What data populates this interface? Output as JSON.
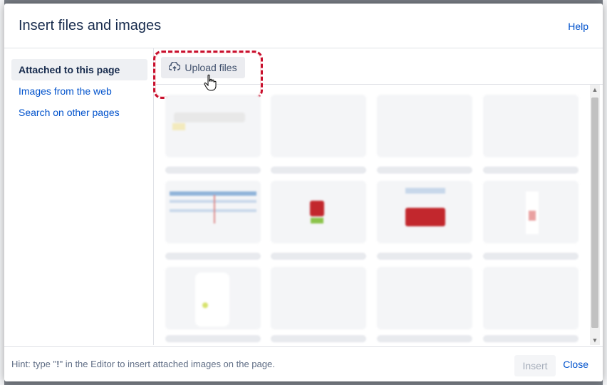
{
  "dialog": {
    "title": "Insert files and images",
    "help": "Help"
  },
  "sidebar": {
    "items": [
      {
        "label": "Attached to this page"
      },
      {
        "label": "Images from the web"
      },
      {
        "label": "Search on other pages"
      }
    ]
  },
  "toolbar": {
    "upload_label": "Upload files"
  },
  "footer": {
    "hint_prefix": "Hint: type \"",
    "hint_key": "!",
    "hint_suffix": "\" in the Editor to insert attached images on the page.",
    "insert_label": "Insert",
    "close_label": "Close"
  },
  "colors": {
    "highlight": "#c8102e",
    "link": "#0052cc"
  },
  "icons": {
    "upload": "cloud-upload-icon",
    "cursor": "hand-pointer-icon"
  }
}
